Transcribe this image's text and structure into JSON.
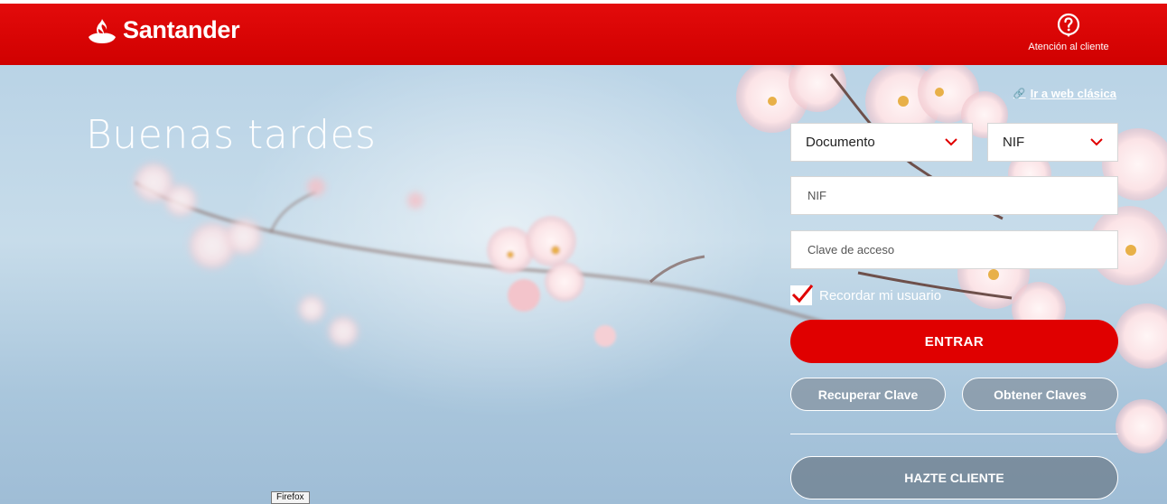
{
  "header": {
    "brand": "Santander",
    "help_label": "Atención al cliente",
    "background_color": "#e00000"
  },
  "hero": {
    "greeting": "Buenas tardes",
    "classic_link": "Ir a web clásica"
  },
  "login": {
    "document_select": {
      "value": "Documento"
    },
    "type_select": {
      "value": "NIF"
    },
    "nif_input": {
      "placeholder": "NIF",
      "value": ""
    },
    "password_input": {
      "placeholder": "Clave de acceso",
      "value": ""
    },
    "remember": {
      "label": "Recordar mi usuario",
      "checked": true
    },
    "enter_button": "ENTRAR",
    "recover_button": "Recuperar Clave",
    "obtain_button": "Obtener Claves",
    "become_client_button": "HAZTE CLIENTE",
    "accent_color": "#e00000"
  },
  "tooltip": {
    "text": "Firefox"
  }
}
